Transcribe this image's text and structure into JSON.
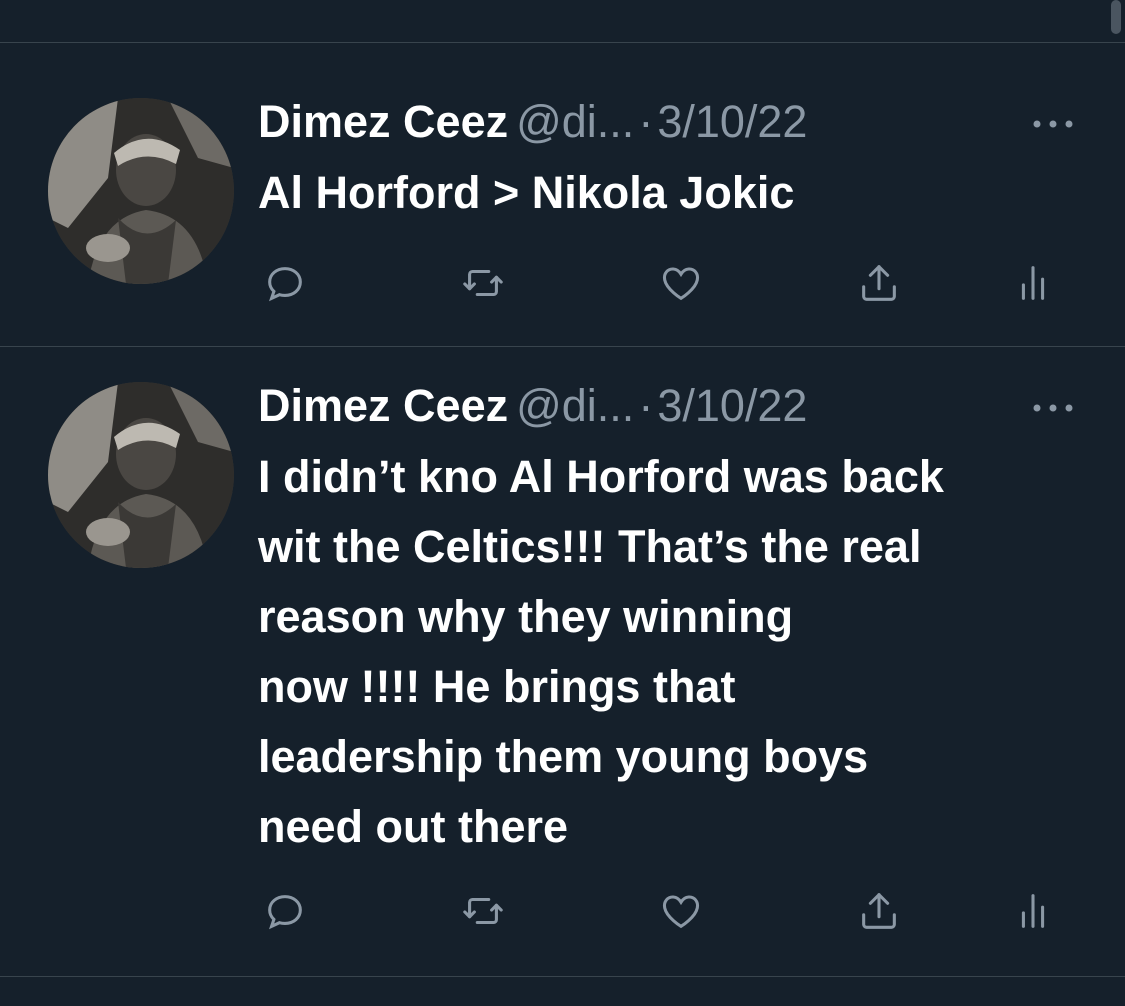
{
  "colors": {
    "background": "#15202b",
    "divider": "#38444d",
    "primary_text": "#ffffff",
    "secondary_text": "#8b98a5"
  },
  "tweets": [
    {
      "display_name": "Dimez Ceez",
      "handle": "@di...",
      "separator": "·",
      "date": "3/10/22",
      "text": "Al Horford > Nikola Jokic",
      "actions": [
        "reply-icon",
        "retweet-icon",
        "like-icon",
        "share-icon",
        "analytics-icon"
      ]
    },
    {
      "display_name": "Dimez Ceez",
      "handle": "@di...",
      "separator": "·",
      "date": "3/10/22",
      "text": "I didn’t kno Al Horford was back\nwit the Celtics!!! That’s the real\nreason why they winning\nnow !!!! He brings that\nleadership them young boys\nneed out there",
      "actions": [
        "reply-icon",
        "retweet-icon",
        "like-icon",
        "share-icon",
        "analytics-icon"
      ]
    }
  ]
}
